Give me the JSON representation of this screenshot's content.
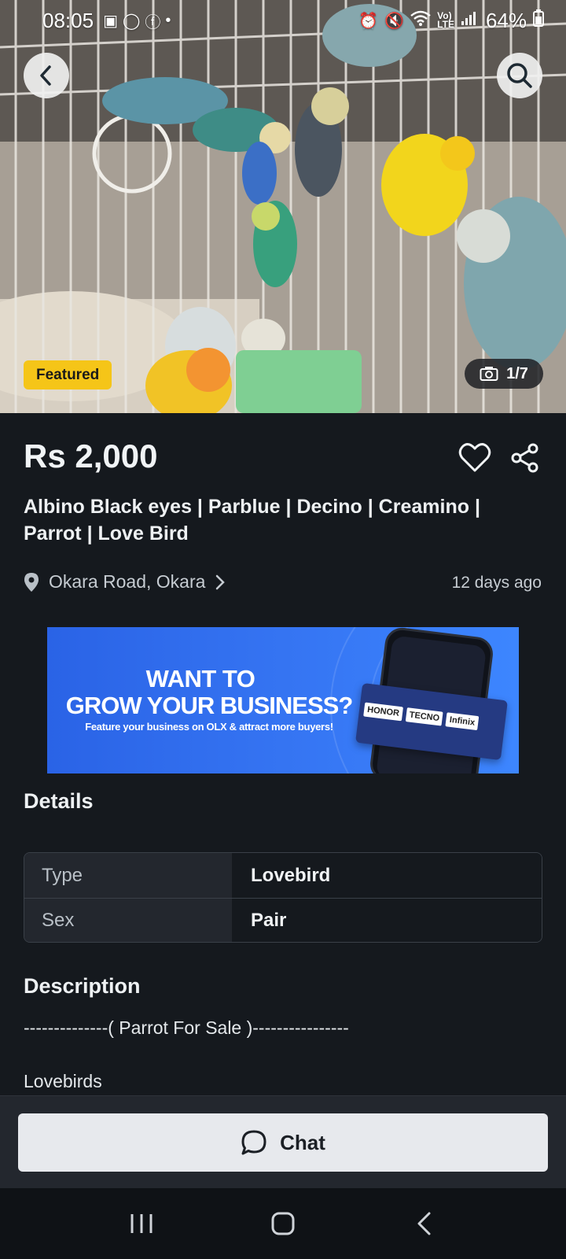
{
  "status_bar": {
    "time": "08:05",
    "battery": "64%",
    "notification_icons": [
      "gallery-icon",
      "whatsapp-icon",
      "facebook-icon",
      "dot-icon"
    ],
    "system_icons": [
      "alarm-icon",
      "mute-icon",
      "wifi-icon",
      "volte-icon",
      "signal-icon",
      "battery-icon"
    ]
  },
  "gallery": {
    "badge": "Featured",
    "counter": "1/7",
    "back_icon": "chevron-left-icon",
    "search_icon": "search-icon"
  },
  "listing": {
    "price": "Rs 2,000",
    "title": "Albino Black eyes | Parblue | Decino | Creamino | Parrot | Love Bird",
    "location": "Okara Road, Okara",
    "posted": "12 days ago"
  },
  "banner": {
    "headline_1": "WANT TO",
    "headline_2": "GROW YOUR BUSINESS?",
    "subline": "Feature your business on OLX & attract more buyers!",
    "brands": [
      "HONOR",
      "TECNO",
      "Infinix"
    ]
  },
  "details": {
    "heading": "Details",
    "rows": [
      {
        "key": "Type",
        "value": "Lovebird"
      },
      {
        "key": "Sex",
        "value": "Pair"
      }
    ]
  },
  "description": {
    "heading": "Description",
    "lines": [
      "--------------( Parrot For Sale )----------------",
      "Lovebirds"
    ]
  },
  "actions": {
    "chat_label": "Chat"
  },
  "colors": {
    "background": "#15191e",
    "featured_badge": "#f5c518",
    "banner_blue": "#3574f2",
    "chat_button": "#e7e9ed"
  }
}
